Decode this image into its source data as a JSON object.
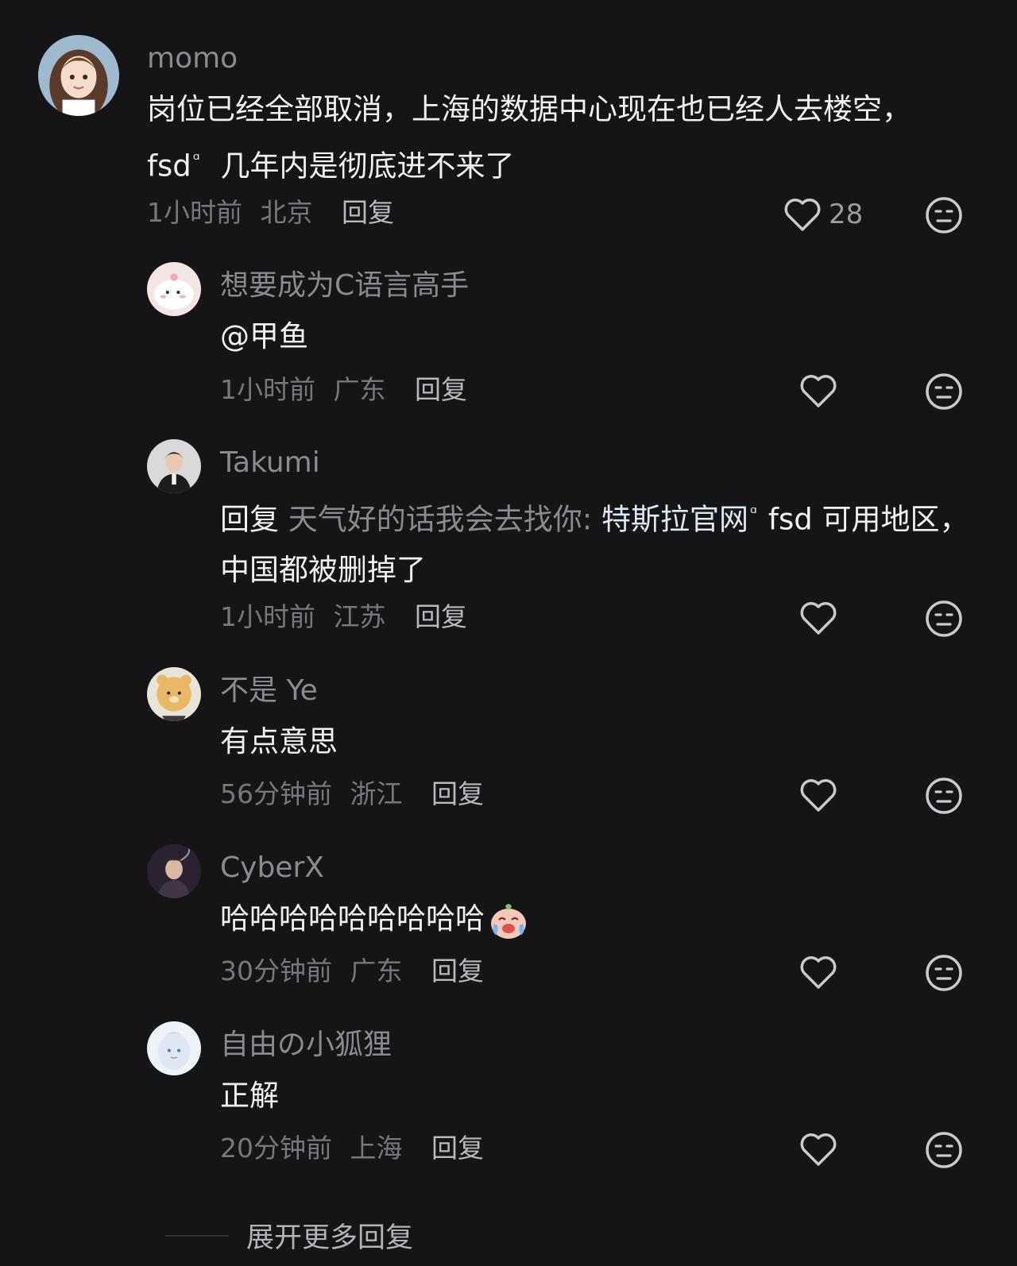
{
  "comments": [
    {
      "username": "momo",
      "content": "岗位已经全部取消，上海的数据中心现在也已经人去楼空， fsd",
      "content_rest": " 几年内是彻底进不来了",
      "time": "1小时前",
      "location": "北京",
      "reply_label": "回复",
      "likes": "28"
    },
    {
      "username": "想要成为C语言高手",
      "content": "@甲鱼",
      "time": "1小时前",
      "location": "广东",
      "reply_label": "回复"
    },
    {
      "username": "Takumi",
      "reply_prefix": "回复",
      "reply_to": "天气好的话我会去找你:",
      "link_text": "特斯拉官网",
      "content": "fsd 可用地区，中国都被删掉了",
      "time": "1小时前",
      "location": "江苏",
      "reply_label": "回复"
    },
    {
      "username": "不是 Ye",
      "content": "有点意思",
      "time": "56分钟前",
      "location": "浙江",
      "reply_label": "回复"
    },
    {
      "username": "CyberX",
      "content": "哈哈哈哈哈哈哈哈哈",
      "time": "30分钟前",
      "location": "广东",
      "reply_label": "回复"
    },
    {
      "username": "自由の小狐狸",
      "content": "正解",
      "time": "20分钟前",
      "location": "上海",
      "reply_label": "回复"
    }
  ],
  "expand_label": "展开更多回复",
  "search_mark": "ᵅ",
  "icons": {
    "like": "heart-outline-icon",
    "dislike": "neutral-face-icon",
    "search": "search-mark-icon",
    "emoji": "crying-laughing-emoji"
  },
  "colors": {
    "background": "#151517",
    "username": "#8a8a90",
    "content": "#f1f1f3",
    "meta": "#77777d"
  }
}
